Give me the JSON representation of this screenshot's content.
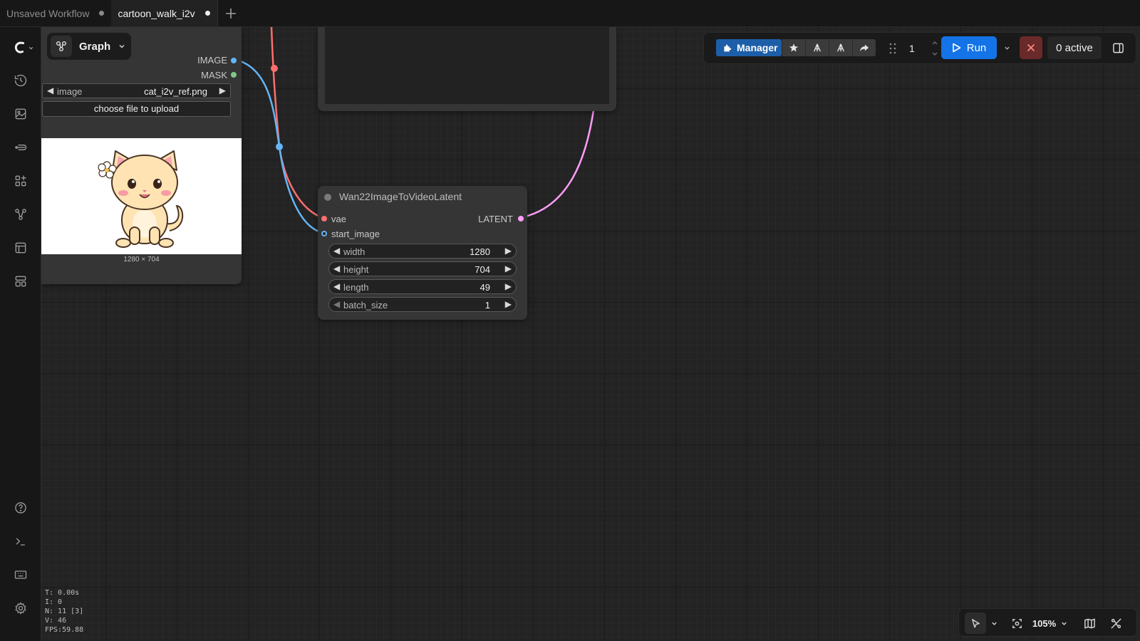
{
  "tabs": [
    {
      "label": "Unsaved Workflow",
      "modified": true,
      "active": false
    },
    {
      "label": "cartoon_walk_i2v",
      "modified": true,
      "active": true
    }
  ],
  "sidebar": {
    "items": [
      "logo-icon",
      "history-icon",
      "image-gallery-icon",
      "model-library-icon",
      "node-library-icon",
      "workflows-icon",
      "templates-icon",
      "queue-icon"
    ],
    "bottom": [
      "help-icon",
      "terminal-icon",
      "keyboard-icon",
      "settings-icon"
    ]
  },
  "graph_menu": {
    "label": "Graph"
  },
  "toolbar": {
    "manager_label": "Manager",
    "queue_count": "1",
    "run_label": "Run",
    "active_label": "0 active",
    "colors": {
      "run": "#1473e6",
      "manager": "#1d5ea8",
      "cancel": "#6b2a2a"
    }
  },
  "load_image_node": {
    "outputs": [
      "IMAGE",
      "MASK"
    ],
    "output_colors": [
      "#64b5f6",
      "#81c784"
    ],
    "image_widget": {
      "label": "image",
      "value": "cat_i2v_ref.png"
    },
    "upload_label": "choose file to upload",
    "preview_size": "1280 × 704"
  },
  "latent_node": {
    "title": "Wan22ImageToVideoLatent",
    "inputs": [
      {
        "name": "vae",
        "color": "#ff6e6e"
      },
      {
        "name": "start_image",
        "color": "#64b5f6"
      }
    ],
    "output": {
      "name": "LATENT",
      "color": "#ff9cf9"
    },
    "widgets": [
      {
        "label": "width",
        "value": "1280"
      },
      {
        "label": "height",
        "value": "704"
      },
      {
        "label": "length",
        "value": "49"
      },
      {
        "label": "batch_size",
        "value": "1"
      }
    ]
  },
  "stats": [
    "T: 0.00s",
    "I: 0",
    "N: 11 [3]",
    "V: 46",
    "FPS:59.88"
  ],
  "canvas_controls": {
    "zoom": "105%"
  }
}
